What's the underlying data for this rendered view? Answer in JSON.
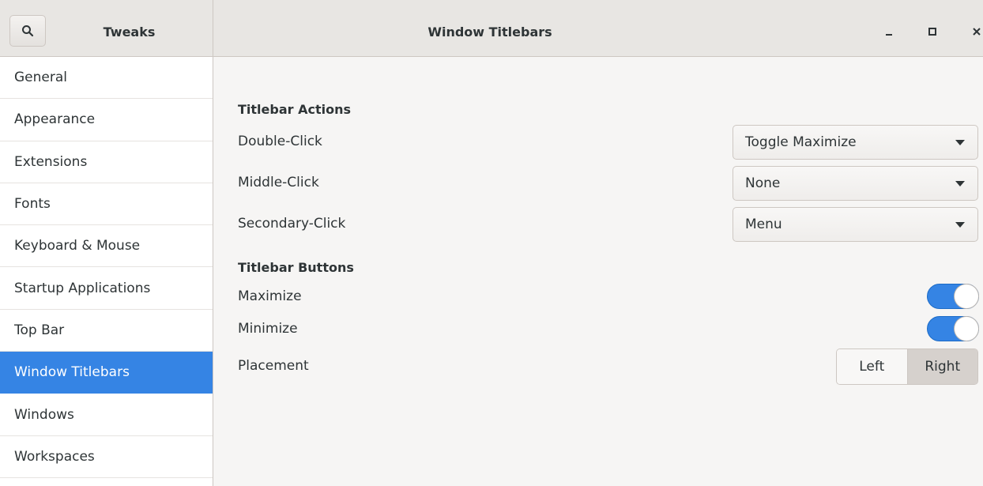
{
  "header": {
    "app_title": "Tweaks",
    "window_title": "Window Titlebars",
    "icons": {
      "search": "search-icon",
      "minimize": "minimize-icon",
      "maximize": "maximize-icon",
      "close": "close-icon"
    }
  },
  "sidebar": {
    "items": [
      {
        "label": "General"
      },
      {
        "label": "Appearance"
      },
      {
        "label": "Extensions"
      },
      {
        "label": "Fonts"
      },
      {
        "label": "Keyboard & Mouse"
      },
      {
        "label": "Startup Applications"
      },
      {
        "label": "Top Bar"
      },
      {
        "label": "Window Titlebars",
        "selected": true
      },
      {
        "label": "Windows"
      },
      {
        "label": "Workspaces"
      }
    ]
  },
  "actions": {
    "title": "Titlebar Actions",
    "double_click": {
      "label": "Double-Click",
      "value": "Toggle Maximize"
    },
    "middle_click": {
      "label": "Middle-Click",
      "value": "None"
    },
    "secondary_click": {
      "label": "Secondary-Click",
      "value": "Menu"
    }
  },
  "buttons": {
    "title": "Titlebar Buttons",
    "maximize": {
      "label": "Maximize",
      "on": true
    },
    "minimize": {
      "label": "Minimize",
      "on": true
    },
    "placement": {
      "label": "Placement",
      "left": "Left",
      "right": "Right",
      "selected": "Right"
    }
  },
  "colors": {
    "accent": "#3584e4",
    "background": "#f6f5f4",
    "headerbar": "#e8e6e3"
  }
}
